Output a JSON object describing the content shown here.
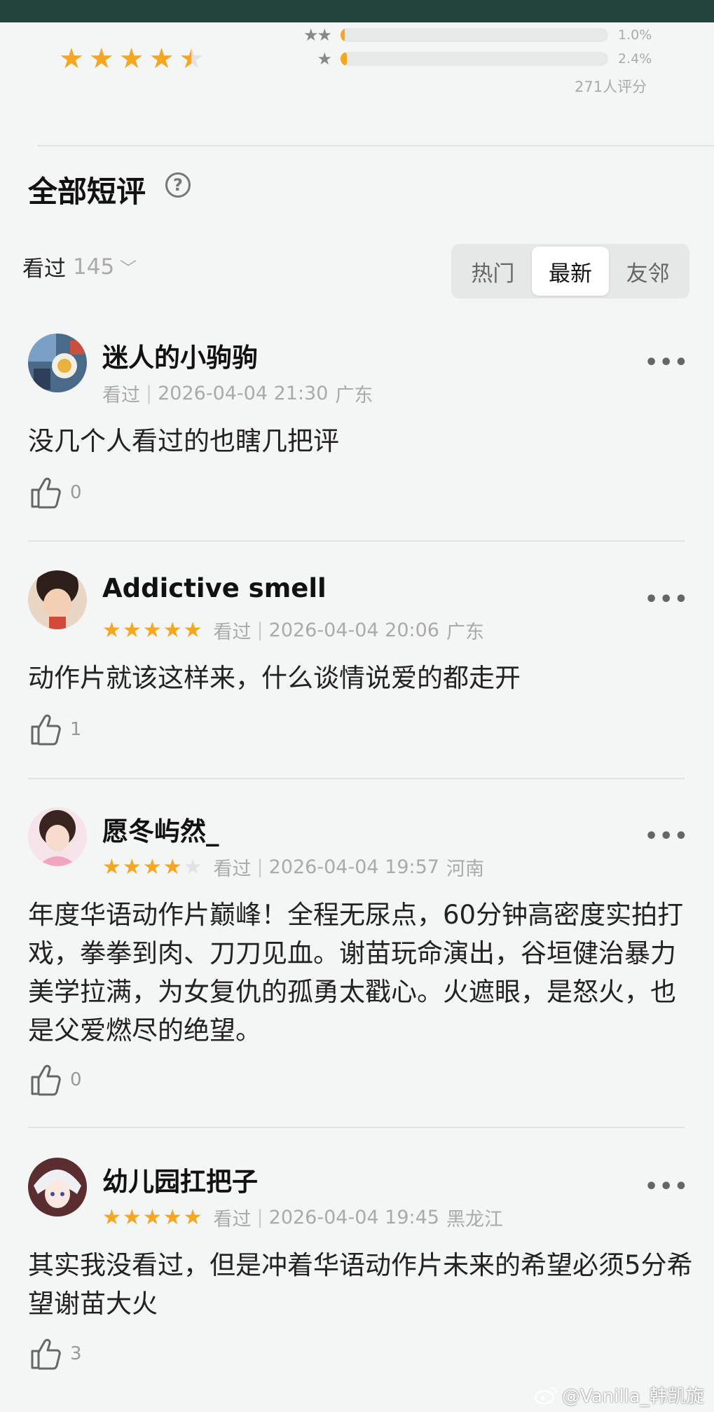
{
  "colors": {
    "accent": "#f5a623",
    "header_bar": "#22443b",
    "background": "#f3f6f4"
  },
  "summary": {
    "average_stars": 4.5,
    "distribution": [
      {
        "stars": "★★",
        "percent": "1.0%",
        "fraction": 0.01
      },
      {
        "stars": "★",
        "percent": "2.4%",
        "fraction": 0.024
      }
    ],
    "rating_count": "271人评分"
  },
  "section": {
    "title": "全部短评",
    "help_icon": "question-circle-icon",
    "filter_label": "看过",
    "filter_count": "145",
    "filter_chevron": "﹀",
    "tabs": [
      {
        "label": "热门",
        "active": false
      },
      {
        "label": "最新",
        "active": true
      },
      {
        "label": "友邻",
        "active": false
      }
    ]
  },
  "comments": [
    {
      "name": "迷人的小驹驹",
      "stars": null,
      "status": "看过",
      "datetime": "2026-04-04 21:30",
      "location": "广东",
      "text": "没几个人看过的也瞎几把评",
      "likes": "0"
    },
    {
      "name": "Addictive smell",
      "stars": 5,
      "status": "看过",
      "datetime": "2026-04-04 20:06",
      "location": "广东",
      "text": "动作片就该这样来，什么谈情说爱的都走开",
      "likes": "1"
    },
    {
      "name": "愿冬屿然_",
      "stars": 4,
      "status": "看过",
      "datetime": "2026-04-04 19:57",
      "location": "河南",
      "text": "年度华语动作片巅峰！全程无尿点，60分钟高密度实拍打戏，拳拳到肉、刀刀见血。谢苗玩命演出，谷垣健治暴力美学拉满，为女复仇的孤勇太戳心。火遮眼，是怒火，也是父爱燃尽的绝望。",
      "likes": "0"
    },
    {
      "name": "幼儿园扛把子",
      "stars": 5,
      "status": "看过",
      "datetime": "2026-04-04 19:45",
      "location": "黑龙江",
      "text": "其实我没看过，但是冲着华语动作片未来的希望必须5分希望谢苗大火",
      "likes": "3"
    }
  ],
  "more_label": "•••",
  "watermark": "@Vanilla_韩凯旋"
}
